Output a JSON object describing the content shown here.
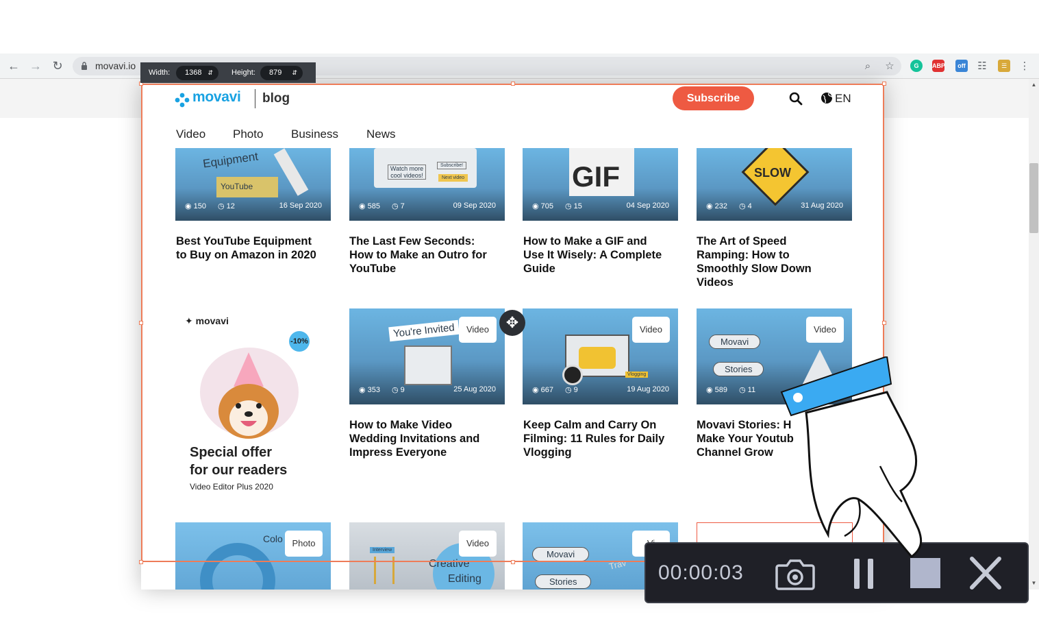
{
  "browser": {
    "url": "movavi.io",
    "back_icon": "arrow-left-icon",
    "forward_icon": "arrow-right-icon",
    "reload_icon": "reload-icon"
  },
  "capture": {
    "width_label": "Width:",
    "width_value": "1368",
    "height_label": "Height:",
    "height_value": "879"
  },
  "site": {
    "brand": "movavi",
    "section": "blog",
    "subscribe": "Subscribe",
    "language": "EN",
    "menu": [
      "Video",
      "Photo",
      "Business",
      "News"
    ],
    "accent": "#19a2e2",
    "subscribe_color": "#ee5a42"
  },
  "cards_row1": [
    {
      "views": "150",
      "time": "12",
      "date": "16 Sep 2020",
      "title_lines": [
        "Best YouTube Equipment",
        "to Buy on Amazon in 2020"
      ]
    },
    {
      "views": "585",
      "time": "7",
      "date": "09 Sep 2020",
      "title_lines": [
        "The Last Few Seconds:",
        "How to Make an Outro for",
        "YouTube"
      ]
    },
    {
      "views": "705",
      "time": "15",
      "date": "04 Sep 2020",
      "title_lines": [
        "How to Make a GIF and",
        "Use It Wisely: A Complete",
        "Guide"
      ]
    },
    {
      "views": "232",
      "time": "4",
      "date": "31 Aug 2020",
      "title_lines": [
        "The Art of Speed",
        "Ramping: How to",
        "Smoothly Slow Down",
        "Videos"
      ]
    }
  ],
  "cards_row2": [
    {
      "badge": "Video",
      "views": "353",
      "time": "9",
      "date": "25 Aug 2020",
      "title_lines": [
        "How to Make Video",
        "Wedding Invitations and",
        "Impress Everyone"
      ]
    },
    {
      "badge": "Video",
      "views": "667",
      "time": "9",
      "date": "19 Aug 2020",
      "title_lines": [
        "Keep Calm and Carry On",
        "Filming: 11 Rules for Daily",
        "Vlogging"
      ]
    },
    {
      "badge": "Video",
      "views": "589",
      "time": "11",
      "date": "",
      "title_lines": [
        "Movavi Stories: H",
        "Make Your Youtub",
        "Channel Grow"
      ]
    }
  ],
  "cards_row3": [
    {
      "badge": "Photo"
    },
    {
      "badge": "Video"
    },
    {
      "badge": "Vi"
    }
  ],
  "promo": {
    "brand": "movavi",
    "discount": "-10%",
    "title_line1": "Special offer",
    "title_line2": "for our readers",
    "subtitle": "Video Editor Plus 2020"
  },
  "art_text": {
    "c1": "Equipment",
    "c1b": "YouTube",
    "c2a": "Watch more",
    "c2b": "cool videos!",
    "c2c": "Subscribe!",
    "c2d": "Next video",
    "c3": "GIF",
    "c4": "SLOW",
    "r2a": "You're Invited",
    "r2c1": "Movavi",
    "r2c2": "Stories",
    "r2b": "Vlogging",
    "r3a": "Colo",
    "r3b": "Creative",
    "r3b2": "Editing",
    "r3b3": "Interview",
    "r3c1": "Movavi",
    "r3c2": "Stories",
    "r3c3": "Trav"
  },
  "recorder": {
    "timer": "00:00:03"
  }
}
